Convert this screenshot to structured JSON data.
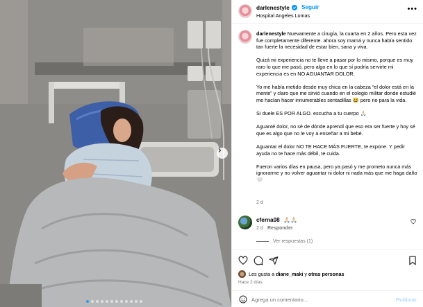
{
  "post": {
    "username": "darlenestyle",
    "follow_label": "Seguir",
    "separator": "•",
    "location": "Hospital Angeles Lomas",
    "more_label": "•••",
    "caption": {
      "p1": "Nuevamente a cirugía, la cuarta en 2 años. Pero esta vez fue completamente diferente. ahora soy mamá y nunca había sentido tan fuerte la necesidad de estar bien, sana y viva.",
      "p2": "Quizá mi experiencia no te lleve a pasar por lo mismo, porque es muy raro lo que me pasó, pero algo en lo que sí podría servirte mi experiencia es en NO AGUANTAR DOLOR.",
      "p3": "Yo me había metido desde muy chica en la cabeza “el dolor está en la mente” y claro que me sirvió cuando en el colegio militar donde estudié me hacían hacer innumerables sentadillas 😂 pero no para la vida.",
      "p4": "Si duele ES POR ALGO. escucha a tu cuerpo 🙏🏻",
      "p5": "Aguanté dolor, no sé de dónde aprendí que eso era ser fuerte y hoy sé que es algo que no le voy a enseñar a mi bebé.",
      "p6": "Aguantar el dolor NO TE HACE MÁS FUERTE, te expone. Y pedir ayuda no te hace más débil, te cuida.",
      "p7": "Fueron varios días en pausa, pero ya pasó y me prometo nunca más ignorarme y no volver aguantar ni dolor ni nada más que me haga daño 🤍",
      "time": "2 d"
    },
    "comment": {
      "username": "cferna08",
      "text": "🙏🏻🙏🏻",
      "time": "2 d",
      "reply_label": "Responder",
      "view_replies": "Ver respuestas (1)"
    },
    "likes": {
      "prefix": "Les gusta a",
      "user": "diane_maki",
      "joiner": "y",
      "others": "otras personas"
    },
    "post_time": "Hace 2 días",
    "comment_placeholder": "Agrega un comentario...",
    "publish_label": "Publicar"
  },
  "carousel": {
    "slide_count": 12,
    "active_index": 0
  },
  "colors": {
    "link_blue": "#0095f6",
    "muted": "#737373",
    "publish_disabled": "#b3dbff"
  },
  "icons": [
    "chevron-right-icon",
    "verified-icon",
    "heart-icon",
    "comment-icon",
    "share-icon",
    "bookmark-icon",
    "emoji-icon"
  ]
}
